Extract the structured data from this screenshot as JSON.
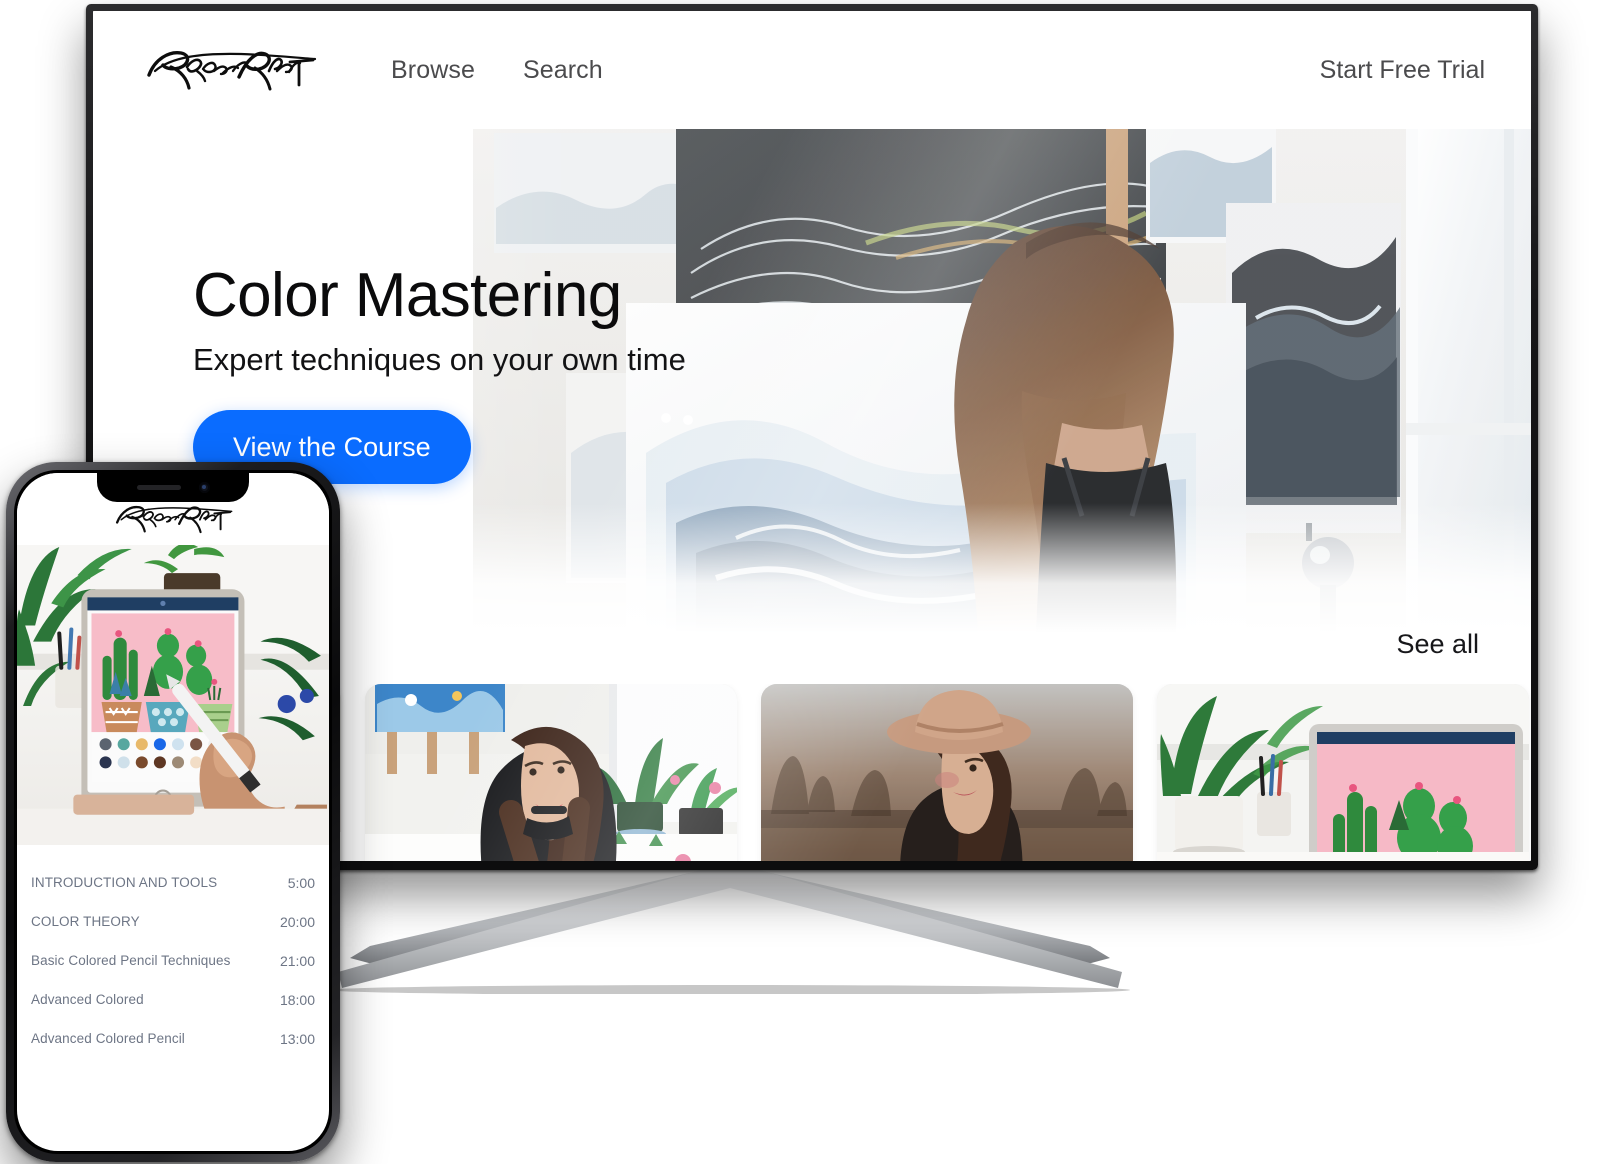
{
  "brand": {
    "logo_icon": "signature-logo-rachel-reinert",
    "logo_text": "Rachel Reinert",
    "accent_color": "#0a6cff",
    "nav_text_color": "#4b4b4d"
  },
  "tv": {
    "nav": {
      "browse_label": "Browse",
      "search_label": "Search",
      "cta_label": "Start Free Trial"
    },
    "hero": {
      "title": "Color Mastering",
      "subtitle": "Expert techniques on your own time",
      "button_label": "View the Course",
      "image_alt": "artist-painting-abstract-blue-canvas"
    },
    "rail": {
      "see_all_label": "See all",
      "cards": [
        {
          "name": "woman-drawing-at-desk"
        },
        {
          "name": "woman-smiling-with-plants"
        },
        {
          "name": "woman-in-hat-in-desert"
        },
        {
          "name": "plants-and-ipad-cactus-art"
        }
      ]
    }
  },
  "phone": {
    "logo_text": "Rachel Reinert",
    "hero_image_alt": "hand-drawing-cacti-on-ipad-with-apple-pencil",
    "lessons": [
      {
        "title": "INTRODUCTION AND TOOLS",
        "duration": "5:00"
      },
      {
        "title": "COLOR THEORY",
        "duration": "20:00"
      },
      {
        "title": "Basic Colored Pencil Techniques",
        "duration": "21:00"
      },
      {
        "title": "Advanced Colored",
        "duration": "18:00"
      },
      {
        "title": "Advanced Colored Pencil",
        "duration": "13:00"
      }
    ]
  }
}
